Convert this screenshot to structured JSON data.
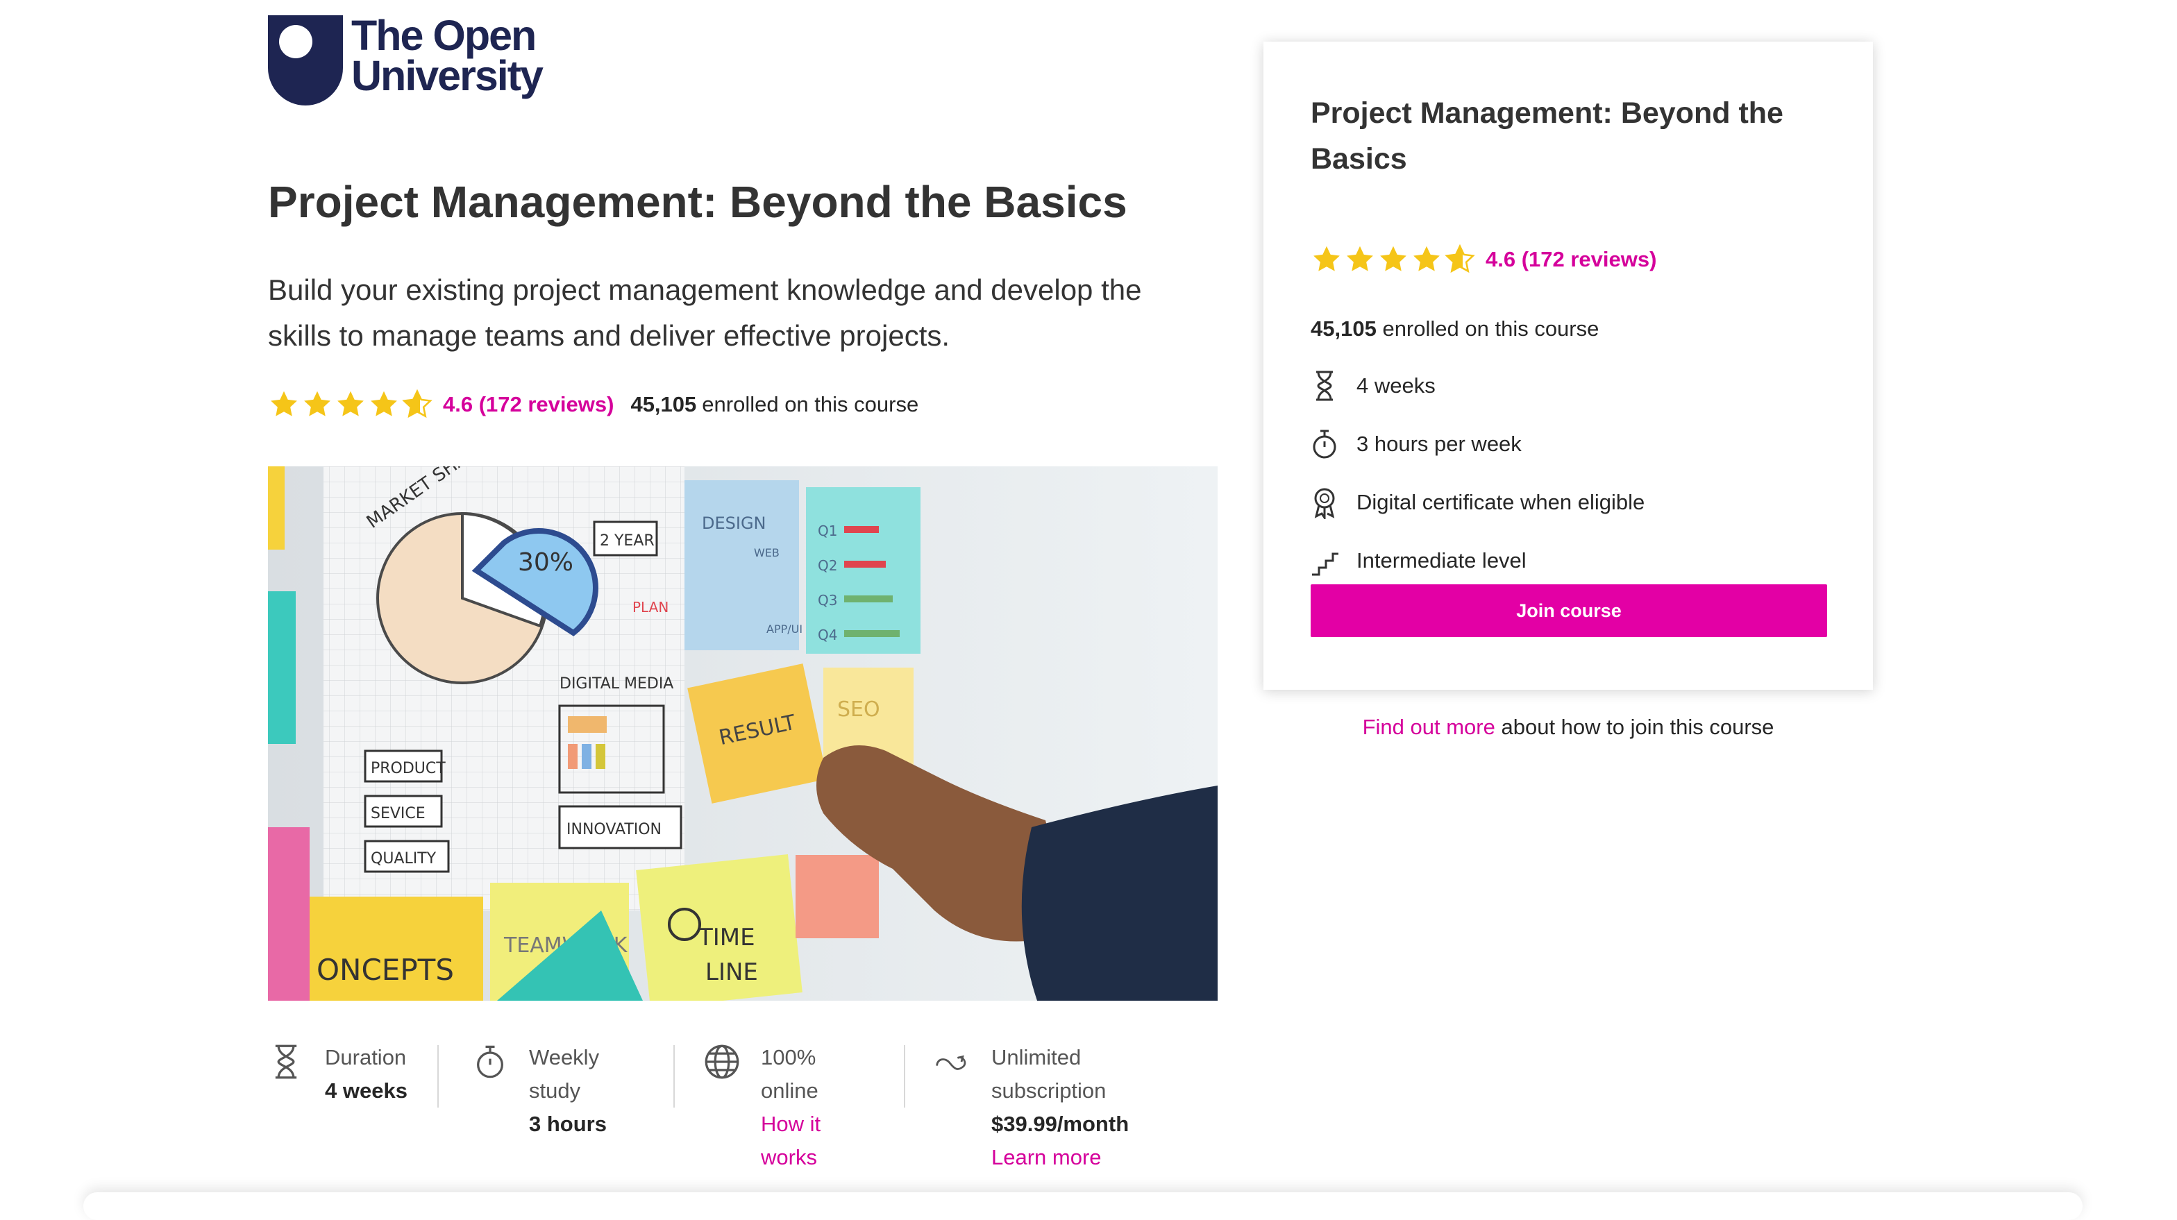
{
  "brand": {
    "name_line1": "The Open",
    "name_line2": "University",
    "color": "#1e2552"
  },
  "colors": {
    "accent": "#d5009b",
    "button": "#e300a5",
    "star": "#f5c518"
  },
  "course": {
    "title": "Project Management: Beyond the Basics",
    "description": "Build your existing project management knowledge and develop the skills to manage teams and deliver effective projects.",
    "rating": 4.6,
    "rating_text": "4.6 (172 reviews)",
    "enrolled_count": "45,105",
    "enrolled_label": "enrolled on this course",
    "hero_image_alt": "Hand placing a sticky note on a project planning board"
  },
  "hero_notes": {
    "market_share": "MARKET SHARE",
    "pct": "30%",
    "year": "2 YEAR",
    "plan": "PLAN",
    "design": "DESIGN",
    "web": "WEB",
    "app": "APP/UI",
    "q1": "Q1",
    "q2": "Q2",
    "q3": "Q3",
    "q4": "Q4",
    "digital_media": "DIGITAL MEDIA",
    "result": "RESULT",
    "seo": "SEO",
    "product": "PRODUCT",
    "service": "SEVICE",
    "quality": "QUALITY",
    "innovation": "INNOVATION",
    "concepts": "ONCEPTS",
    "teamwork": "TEAMWORK",
    "time": "TIME",
    "line": "LINE"
  },
  "info_strip": [
    {
      "icon": "hourglass-icon",
      "label": "Duration",
      "value": "4 weeks"
    },
    {
      "icon": "stopwatch-icon",
      "label_line1": "Weekly",
      "label_line2": "study",
      "value": "3 hours"
    },
    {
      "icon": "globe-icon",
      "label_line1": "100%",
      "label_line2": "online",
      "link_line1": "How it",
      "link_line2": "works"
    },
    {
      "icon": "infinity-icon",
      "label_line1": "Unlimited",
      "label_line2": "subscription",
      "value": "$39.99/month",
      "link": "Learn more"
    }
  ],
  "sidebar": {
    "title": "Project Management: Beyond the Basics",
    "rating_text": "4.6 (172 reviews)",
    "enrolled_count": "45,105",
    "enrolled_label": "enrolled on this course",
    "features": [
      {
        "icon": "hourglass-icon",
        "label": "4 weeks"
      },
      {
        "icon": "stopwatch-icon",
        "label": "3 hours per week"
      },
      {
        "icon": "certificate-icon",
        "label": "Digital certificate when eligible"
      },
      {
        "icon": "stairs-icon",
        "label": "Intermediate level"
      }
    ],
    "join_label": "Join course",
    "find_more_link": "Find out more",
    "find_more_text": "about how to join this course"
  }
}
